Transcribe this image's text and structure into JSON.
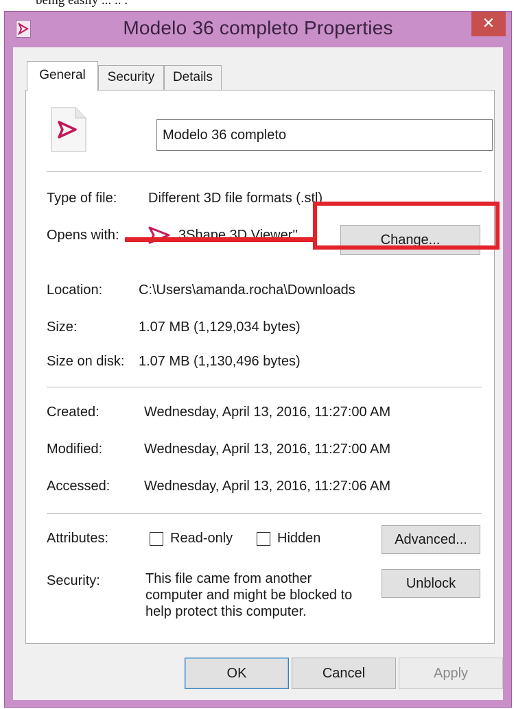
{
  "caption_top": "being easily ... .. .",
  "window": {
    "title": "Modelo 36 completo Properties",
    "close_glyph": "✕"
  },
  "tabs": [
    {
      "label": "General",
      "active": true
    },
    {
      "label": "Security",
      "active": false
    },
    {
      "label": "Details",
      "active": false
    }
  ],
  "general": {
    "file_name": "Modelo 36 completo",
    "type_of_file": {
      "label": "Type of file:",
      "value": "Different 3D file formats (.stl)"
    },
    "opens_with": {
      "label": "Opens with:",
      "value": "3Shape 3D Viewer''",
      "change_button": "Change..."
    },
    "location": {
      "label": "Location:",
      "value": "C:\\Users\\amanda.rocha\\Downloads"
    },
    "size": {
      "label": "Size:",
      "value": "1.07 MB (1,129,034 bytes)"
    },
    "size_on_disk": {
      "label": "Size on disk:",
      "value": "1.07 MB (1,130,496 bytes)"
    },
    "created": {
      "label": "Created:",
      "value": "Wednesday, April 13, 2016, 11:27:00 AM"
    },
    "modified": {
      "label": "Modified:",
      "value": "Wednesday, April 13, 2016, 11:27:00 AM"
    },
    "accessed": {
      "label": "Accessed:",
      "value": "Wednesday, April 13, 2016, 11:27:06 AM"
    },
    "attributes": {
      "label": "Attributes:",
      "read_only": {
        "label": "Read-only",
        "checked": false
      },
      "hidden": {
        "label": "Hidden",
        "checked": false
      },
      "advanced_button": "Advanced..."
    },
    "security": {
      "label": "Security:",
      "text_lines": [
        "This file came from another",
        "computer and might be blocked to",
        "help protect this computer."
      ],
      "unblock_button": "Unblock"
    }
  },
  "footer": {
    "ok": "OK",
    "cancel": "Cancel",
    "apply": "Apply"
  },
  "colors": {
    "titlebar": "#c98fc9",
    "close": "#c7504f",
    "annotation": "#e3232a",
    "app_icon": "#c2185b"
  },
  "icons": {
    "app": "3shape-viewer-icon",
    "file": "stl-file-icon",
    "close": "close-icon"
  }
}
